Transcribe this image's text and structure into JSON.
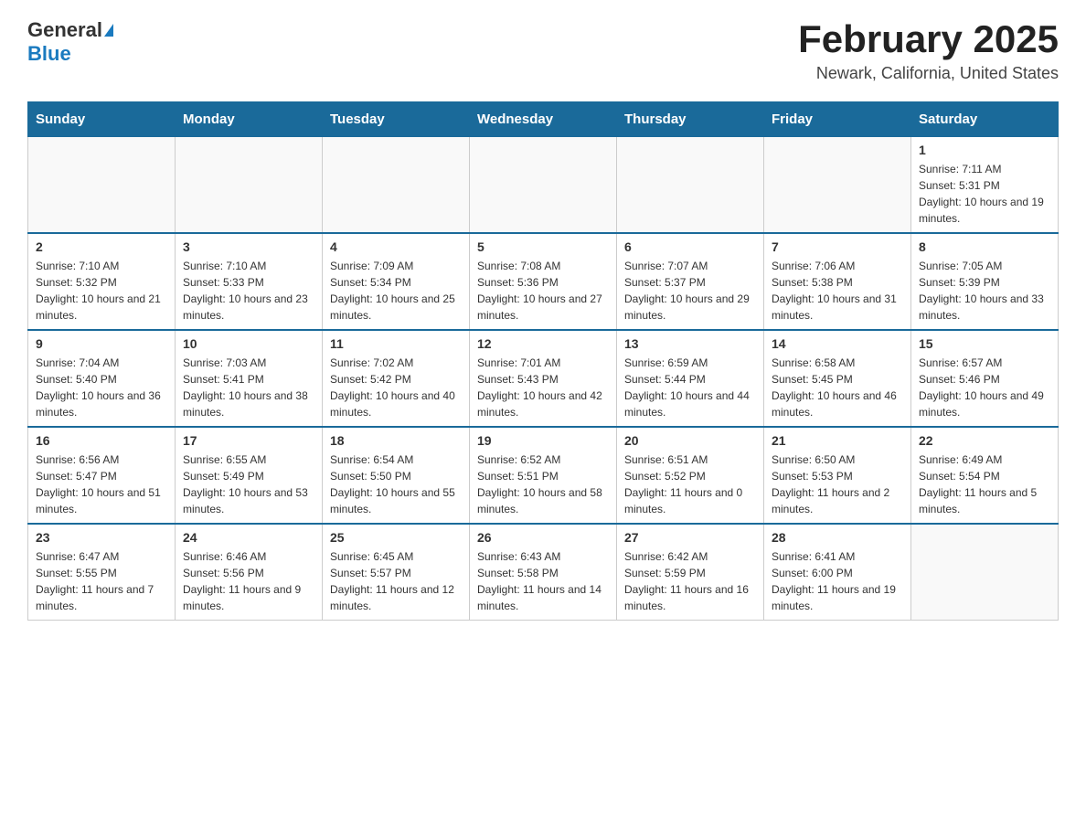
{
  "logo": {
    "general": "General",
    "blue": "Blue"
  },
  "title": "February 2025",
  "location": "Newark, California, United States",
  "days_of_week": [
    "Sunday",
    "Monday",
    "Tuesday",
    "Wednesday",
    "Thursday",
    "Friday",
    "Saturday"
  ],
  "weeks": [
    [
      {
        "day": "",
        "info": ""
      },
      {
        "day": "",
        "info": ""
      },
      {
        "day": "",
        "info": ""
      },
      {
        "day": "",
        "info": ""
      },
      {
        "day": "",
        "info": ""
      },
      {
        "day": "",
        "info": ""
      },
      {
        "day": "1",
        "info": "Sunrise: 7:11 AM\nSunset: 5:31 PM\nDaylight: 10 hours and 19 minutes."
      }
    ],
    [
      {
        "day": "2",
        "info": "Sunrise: 7:10 AM\nSunset: 5:32 PM\nDaylight: 10 hours and 21 minutes."
      },
      {
        "day": "3",
        "info": "Sunrise: 7:10 AM\nSunset: 5:33 PM\nDaylight: 10 hours and 23 minutes."
      },
      {
        "day": "4",
        "info": "Sunrise: 7:09 AM\nSunset: 5:34 PM\nDaylight: 10 hours and 25 minutes."
      },
      {
        "day": "5",
        "info": "Sunrise: 7:08 AM\nSunset: 5:36 PM\nDaylight: 10 hours and 27 minutes."
      },
      {
        "day": "6",
        "info": "Sunrise: 7:07 AM\nSunset: 5:37 PM\nDaylight: 10 hours and 29 minutes."
      },
      {
        "day": "7",
        "info": "Sunrise: 7:06 AM\nSunset: 5:38 PM\nDaylight: 10 hours and 31 minutes."
      },
      {
        "day": "8",
        "info": "Sunrise: 7:05 AM\nSunset: 5:39 PM\nDaylight: 10 hours and 33 minutes."
      }
    ],
    [
      {
        "day": "9",
        "info": "Sunrise: 7:04 AM\nSunset: 5:40 PM\nDaylight: 10 hours and 36 minutes."
      },
      {
        "day": "10",
        "info": "Sunrise: 7:03 AM\nSunset: 5:41 PM\nDaylight: 10 hours and 38 minutes."
      },
      {
        "day": "11",
        "info": "Sunrise: 7:02 AM\nSunset: 5:42 PM\nDaylight: 10 hours and 40 minutes."
      },
      {
        "day": "12",
        "info": "Sunrise: 7:01 AM\nSunset: 5:43 PM\nDaylight: 10 hours and 42 minutes."
      },
      {
        "day": "13",
        "info": "Sunrise: 6:59 AM\nSunset: 5:44 PM\nDaylight: 10 hours and 44 minutes."
      },
      {
        "day": "14",
        "info": "Sunrise: 6:58 AM\nSunset: 5:45 PM\nDaylight: 10 hours and 46 minutes."
      },
      {
        "day": "15",
        "info": "Sunrise: 6:57 AM\nSunset: 5:46 PM\nDaylight: 10 hours and 49 minutes."
      }
    ],
    [
      {
        "day": "16",
        "info": "Sunrise: 6:56 AM\nSunset: 5:47 PM\nDaylight: 10 hours and 51 minutes."
      },
      {
        "day": "17",
        "info": "Sunrise: 6:55 AM\nSunset: 5:49 PM\nDaylight: 10 hours and 53 minutes."
      },
      {
        "day": "18",
        "info": "Sunrise: 6:54 AM\nSunset: 5:50 PM\nDaylight: 10 hours and 55 minutes."
      },
      {
        "day": "19",
        "info": "Sunrise: 6:52 AM\nSunset: 5:51 PM\nDaylight: 10 hours and 58 minutes."
      },
      {
        "day": "20",
        "info": "Sunrise: 6:51 AM\nSunset: 5:52 PM\nDaylight: 11 hours and 0 minutes."
      },
      {
        "day": "21",
        "info": "Sunrise: 6:50 AM\nSunset: 5:53 PM\nDaylight: 11 hours and 2 minutes."
      },
      {
        "day": "22",
        "info": "Sunrise: 6:49 AM\nSunset: 5:54 PM\nDaylight: 11 hours and 5 minutes."
      }
    ],
    [
      {
        "day": "23",
        "info": "Sunrise: 6:47 AM\nSunset: 5:55 PM\nDaylight: 11 hours and 7 minutes."
      },
      {
        "day": "24",
        "info": "Sunrise: 6:46 AM\nSunset: 5:56 PM\nDaylight: 11 hours and 9 minutes."
      },
      {
        "day": "25",
        "info": "Sunrise: 6:45 AM\nSunset: 5:57 PM\nDaylight: 11 hours and 12 minutes."
      },
      {
        "day": "26",
        "info": "Sunrise: 6:43 AM\nSunset: 5:58 PM\nDaylight: 11 hours and 14 minutes."
      },
      {
        "day": "27",
        "info": "Sunrise: 6:42 AM\nSunset: 5:59 PM\nDaylight: 11 hours and 16 minutes."
      },
      {
        "day": "28",
        "info": "Sunrise: 6:41 AM\nSunset: 6:00 PM\nDaylight: 11 hours and 19 minutes."
      },
      {
        "day": "",
        "info": ""
      }
    ]
  ]
}
